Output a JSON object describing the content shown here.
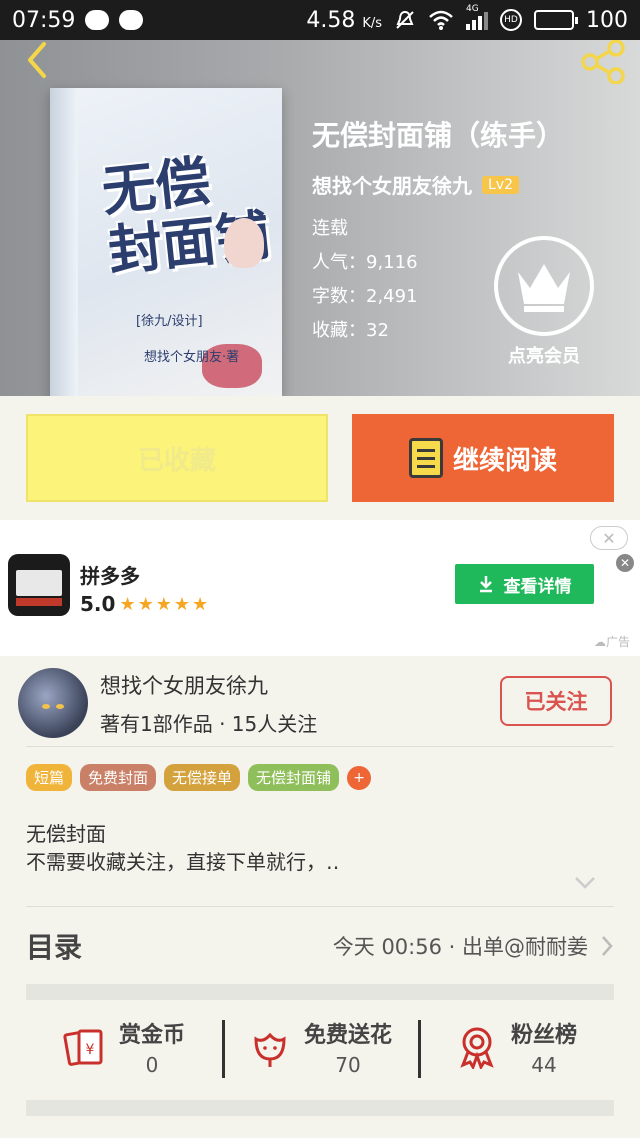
{
  "status_bar": {
    "time": "07:59",
    "network_speed": "4.58",
    "speed_unit": "K/s",
    "signal_type": "4G",
    "battery": "100",
    "icons": [
      "chat-bubble-icon",
      "wechat-icon",
      "mute-icon",
      "wifi-icon",
      "signal-icon",
      "hd-icon",
      "battery-icon"
    ]
  },
  "header": {
    "back_icon": "chevron-left-icon",
    "share_icon": "share-icon",
    "book_title": "无偿封面铺（练手）",
    "author": "想找个女朋友徐九",
    "level": "Lv2",
    "status": "连载",
    "popularity": "人气：9,116",
    "word_count": "字数：2,491",
    "favorites": "收藏：32",
    "vip_label": "点亮会员",
    "cover": {
      "title_line1": "无偿",
      "title_line2": "封面铺",
      "tag": "[徐九/设计]",
      "author_tag": "想找个女朋友·著"
    }
  },
  "actions": {
    "favorite_label": "已收藏",
    "read_label": "继续阅读"
  },
  "ad": {
    "app_name": "拼多多",
    "rating": "5.0",
    "stars": "★★★★★",
    "button_label": "查看详情",
    "ad_mark": "广告",
    "close_label": "✕"
  },
  "author_section": {
    "name": "想找个女朋友徐九",
    "stats": "著有1部作品 · 15人关注",
    "follow_label": "已关注"
  },
  "tags": [
    {
      "label": "短篇",
      "color": "#f0b43a"
    },
    {
      "label": "免费封面",
      "color": "#c98066"
    },
    {
      "label": "无偿接单",
      "color": "#d4a23c"
    },
    {
      "label": "无偿封面铺",
      "color": "#8fbf5a"
    }
  ],
  "description": {
    "title": "无偿封面",
    "body": "不需要收藏关注，直接下单就行，‥"
  },
  "toc": {
    "label": "目录",
    "latest": "今天 00:56 · 出单@耐耐姜"
  },
  "stats": [
    {
      "label": "赏金币",
      "value": "0",
      "icon": "red-envelope-icon"
    },
    {
      "label": "免费送花",
      "value": "70",
      "icon": "flower-icon"
    },
    {
      "label": "粉丝榜",
      "value": "44",
      "icon": "medal-icon"
    }
  ],
  "colors": {
    "accent": "#ee6536",
    "favorite_button": "#fbf37a",
    "follow": "#d9534f",
    "ad_button": "#1fb85a"
  }
}
